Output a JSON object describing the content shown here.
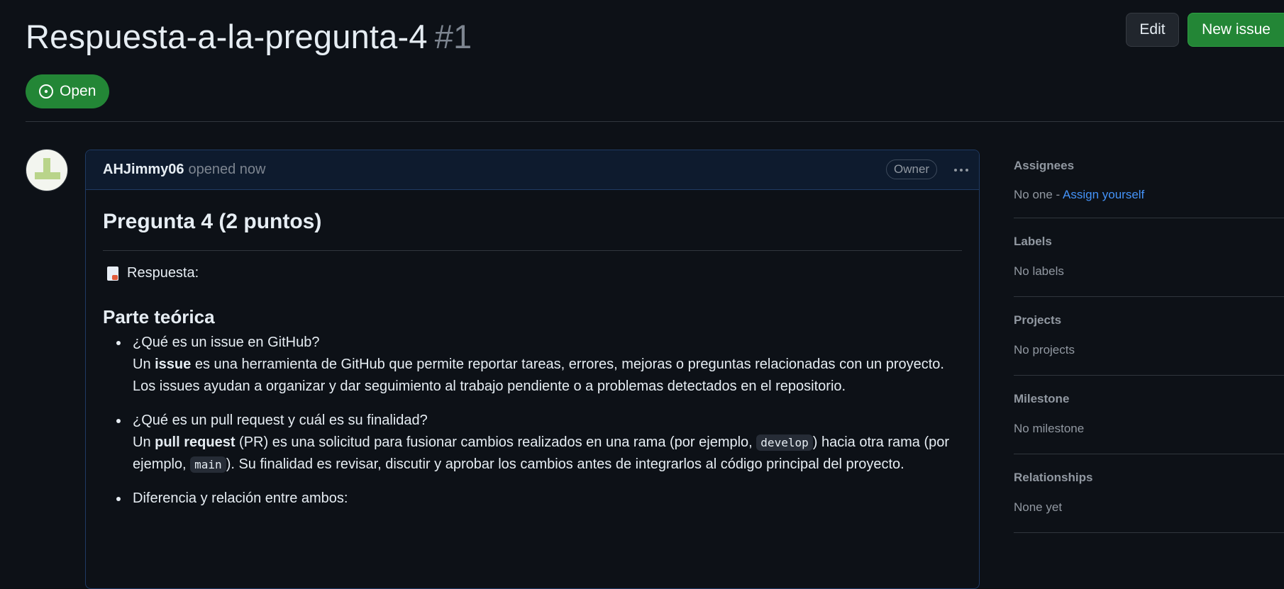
{
  "issue": {
    "title": "Respuesta-a-la-pregunta-4",
    "number": "#1",
    "state": "Open"
  },
  "header_buttons": {
    "edit": "Edit",
    "new_issue": "New issue"
  },
  "comment": {
    "author": "AHJimmy06",
    "opened": "opened now",
    "badge": "Owner",
    "h1": "Pregunta 4 (2 puntos)",
    "respuesta_label": "Respuesta:",
    "h2": "Parte teórica",
    "items": [
      {
        "question": "¿Qué es un issue en GitHub?",
        "pre": "Un ",
        "term": "issue",
        "text": " es una herramienta de GitHub que permite reportar tareas, errores, mejoras o preguntas relacionadas con un proyecto. Los issues ayudan a organizar y dar seguimiento al trabajo pendiente o a problemas detectados en el repositorio."
      },
      {
        "question": "¿Qué es un pull request y cuál es su finalidad?",
        "pre": "Un ",
        "term": "pull request",
        "text_a": " (PR) es una solicitud para fusionar cambios realizados en una rama (por ejemplo, ",
        "code_a": "develop",
        "text_b": ") hacia otra rama (por ejemplo, ",
        "code_b": "main",
        "text_c": "). Su finalidad es revisar, discutir y aprobar los cambios antes de integrarlos al código principal del proyecto."
      },
      {
        "question": "Diferencia y relación entre ambos:"
      }
    ]
  },
  "sidebar": {
    "assignees": {
      "label": "Assignees",
      "value": "No one - ",
      "link": "Assign yourself"
    },
    "labels": {
      "label": "Labels",
      "value": "No labels"
    },
    "projects": {
      "label": "Projects",
      "value": "No projects"
    },
    "milestone": {
      "label": "Milestone",
      "value": "No milestone"
    },
    "relationships": {
      "label": "Relationships",
      "value": "None yet"
    }
  }
}
